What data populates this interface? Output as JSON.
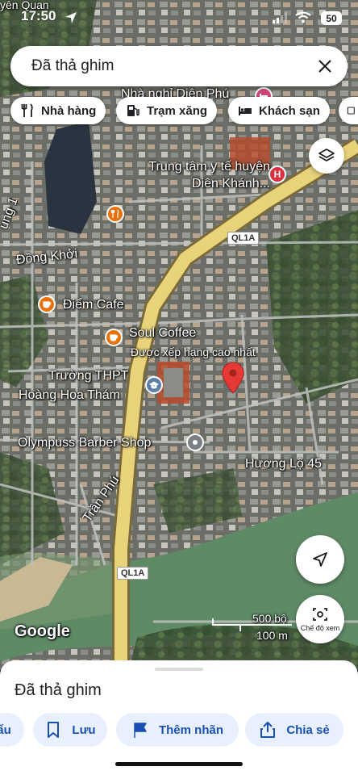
{
  "status_bar": {
    "time": "17:50",
    "battery": "50"
  },
  "search": {
    "query": "Đã thả ghim"
  },
  "chips": [
    {
      "label": "Nhà hàng",
      "icon": "restaurant-icon"
    },
    {
      "label": "Trạm xăng",
      "icon": "gas-station-icon"
    },
    {
      "label": "Khách sạn",
      "icon": "hotel-icon"
    }
  ],
  "map": {
    "labels": {
      "top_left": "yên Quan",
      "top_place": "Nhà nghỉ Diên Phú",
      "hospital": "Trung tâm y tế huyện Diên Khánh...",
      "road_dong_khoi": "Đồng Khởi",
      "road_left": "ung 1",
      "cafe1": "Điểm Cafe",
      "cafe2": "Soul Coffee",
      "cafe2_sub": "Được xếp hạng cao nhất",
      "school_line1": "Trường THPT",
      "school_line2": "Hoàng Hoa Thám",
      "barber": "Olympuss Barber Shop",
      "huong_lo": "Hương Lộ 45",
      "tran_phu": "Trần Phú",
      "google": "Google"
    },
    "highway_shield": "QL1A",
    "highway_shield_bottom": "QL1A",
    "scale": {
      "imperial": "500 bộ",
      "metric": "100 m"
    },
    "street_view_label": "Chế độ xem",
    "colors": {
      "pin": "#e53935",
      "highway": "#e8d27a",
      "river": "#5f8a66"
    }
  },
  "sheet": {
    "title": "Đã thả ghim",
    "actions": [
      {
        "label": "ẩu",
        "icon": "directions-icon"
      },
      {
        "label": "Lưu",
        "icon": "bookmark-icon"
      },
      {
        "label": "Thêm nhãn",
        "icon": "flag-icon"
      },
      {
        "label": "Chia sẻ",
        "icon": "share-icon"
      }
    ]
  }
}
